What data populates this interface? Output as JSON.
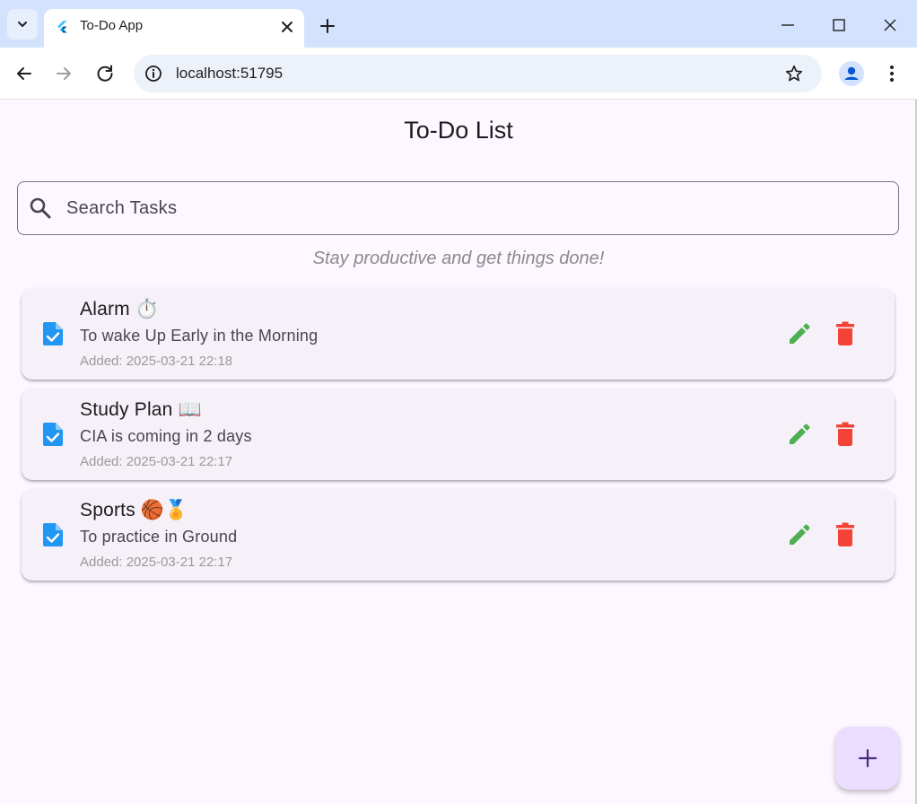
{
  "browser": {
    "tab_title": "To-Do App",
    "url": "localhost:51795"
  },
  "app": {
    "title": "To-Do List",
    "search_placeholder": "Search Tasks",
    "search_value": "",
    "tagline": "Stay productive and get things done!",
    "tasks": [
      {
        "title": "Alarm ⏱️",
        "description": "To wake Up Early in the Morning",
        "added": "Added: 2025-03-21 22:18"
      },
      {
        "title": "Study Plan 📖",
        "description": "CIA is coming in 2 days",
        "added": "Added: 2025-03-21 22:17"
      },
      {
        "title": "Sports 🏀🏅",
        "description": "To practice in Ground",
        "added": "Added: 2025-03-21 22:17"
      }
    ]
  },
  "icons": {
    "tab_menu": "chevron-down-icon",
    "favicon": "flutter-icon",
    "tab_close": "close-icon",
    "new_tab": "plus-icon",
    "back": "arrow-back-icon",
    "forward": "arrow-forward-icon",
    "reload": "reload-icon",
    "site_info": "info-icon",
    "bookmark": "star-icon",
    "profile": "account-icon",
    "menu": "kebab-menu-icon",
    "search": "search-icon",
    "task": "task-document-icon",
    "edit": "pencil-icon",
    "delete": "trash-icon",
    "add": "plus-icon"
  },
  "colors": {
    "background": "#fdf7ff",
    "card": "#f6f0f8",
    "task_icon": "#2196f3",
    "edit": "#4caf50",
    "delete": "#f44336",
    "fab": "#eaddff",
    "fab_icon": "#4a2d7a",
    "tabstrip": "#d3e3fd"
  }
}
